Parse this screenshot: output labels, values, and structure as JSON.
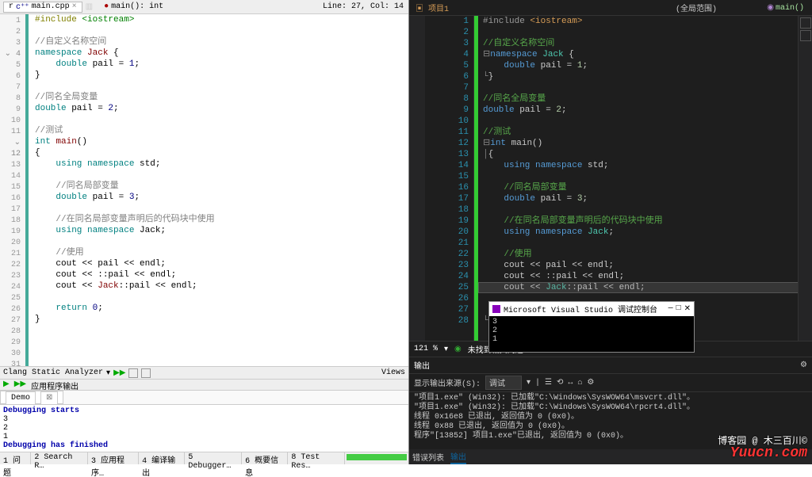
{
  "left": {
    "tab_filename": "main.cpp",
    "function_sig": "main(): int",
    "line_status": "Line: 27, Col: 14",
    "analyzer": "Clang Static Analyzer",
    "views": "Views",
    "output_label": "应用程序输出",
    "output_tab": "Demo",
    "perms": "r",
    "func_icon": "●",
    "code": [
      "#include <iostream>",
      "",
      "//自定义名称空间",
      "namespace Jack {",
      "    double pail = 1;",
      "}",
      "",
      "//同名全局变量",
      "double pail = 2;",
      "",
      "//测试",
      "int main()",
      "{",
      "    using namespace std;",
      "",
      "    //同名局部变量",
      "    double pail = 3;",
      "",
      "    //在同名局部变量声明后的代码块中使用",
      "    using namespace Jack;",
      "",
      "    //使用",
      "    cout << pail << endl;",
      "    cout << ::pail << endl;",
      "    cout << Jack::pail << endl;",
      "",
      "    return 0;",
      "}"
    ],
    "output_lines": [
      "Debugging starts",
      "3",
      "2",
      "1",
      "Debugging has finished"
    ],
    "bottom_tabs": [
      "1 问题",
      "2 Search R…",
      "3 应用程序…",
      "4 编译输出",
      "5 Debugger…",
      "6 概要信息",
      "8 Test Res…"
    ]
  },
  "right": {
    "project": "项目1",
    "scope": "(全局范围)",
    "function": "main()",
    "code": [
      "#include <iostream>",
      "",
      "//自定义名称空间",
      "namespace Jack {",
      "    double pail = 1;",
      "}",
      "",
      "//同名全局变量",
      "double pail = 2;",
      "",
      "//测试",
      "int main()",
      "{",
      "    using namespace std;",
      "",
      "    //同名局部变量",
      "    double pail = 3;",
      "",
      "    //在同名局部变量声明后的代码块中使用",
      "    using namespace Jack;",
      "",
      "    //使用",
      "    cout << pail << endl;",
      "    cout << ::pail << endl;",
      "    cout << Jack::pail << endl;",
      "",
      "    return 0;",
      "}"
    ],
    "zoom": "121 %",
    "issues": "未找到相关问题",
    "output_title": "输出",
    "output_src_label": "显示输出来源(S):",
    "output_src_value": "调试",
    "output_lines": [
      "\"项目1.exe\" (Win32): 已加载\"C:\\Windows\\SysWOW64\\msvcrt.dll\"。",
      "\"项目1.exe\" (Win32): 已加载\"C:\\Windows\\SysWOW64\\rpcrt4.dll\"。",
      "线程 0x16e8 已退出, 返回值为 0 (0x0)。",
      "线程 0x88 已退出, 返回值为 0 (0x0)。",
      "程序\"[13852] 项目1.exe\"已退出, 返回值为 0 (0x0)。"
    ],
    "bottom_tabs": {
      "a": "错误列表",
      "b": "输出"
    },
    "tool_icons": "▾ | ☰ ⟲ ↔ ⌂ ⚙"
  },
  "console": {
    "title": "Microsoft Visual Studio 调试控制台",
    "lines": [
      "3",
      "2",
      "1"
    ],
    "btns": {
      "min": "—",
      "max": "□",
      "close": "✕"
    }
  },
  "watermark": {
    "site": "Yuucn.com",
    "blog": "博客园 @ 木三百川©"
  }
}
